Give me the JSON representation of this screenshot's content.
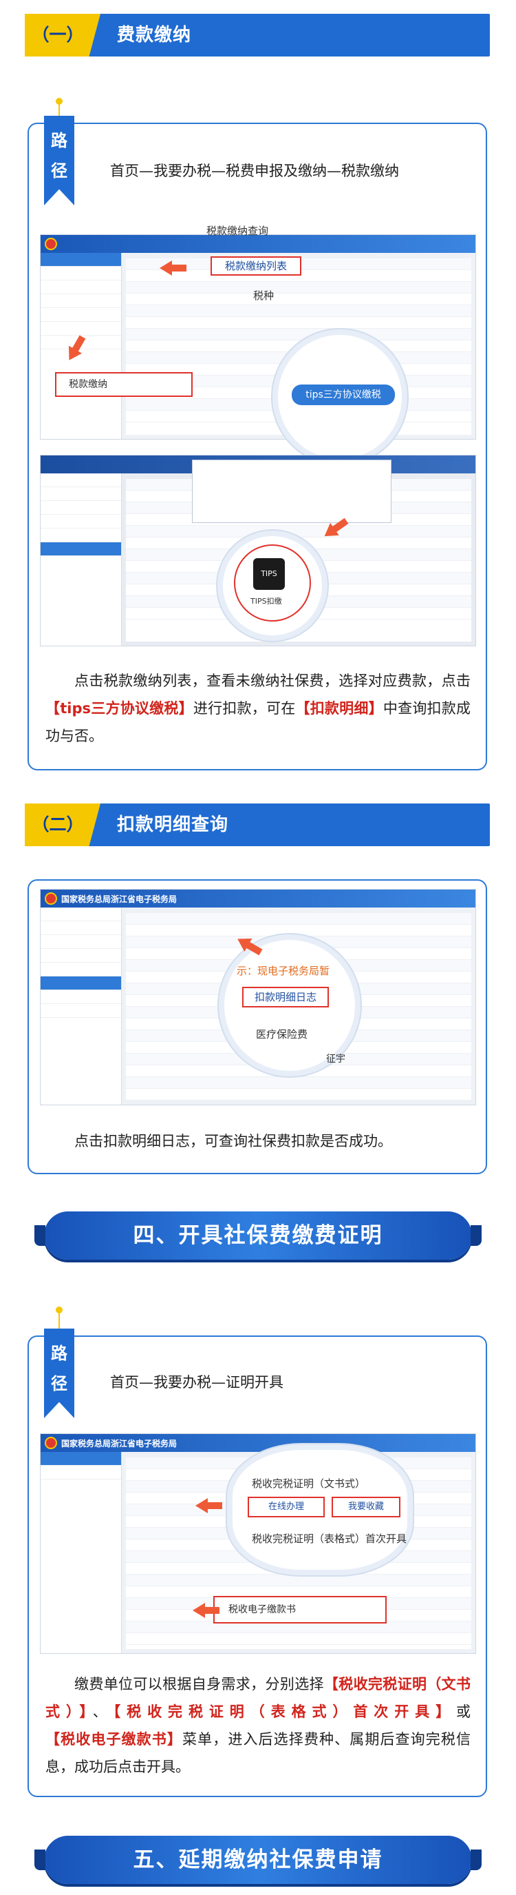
{
  "section1": {
    "num": "（一）",
    "title": "费款缴纳"
  },
  "card1": {
    "path_label": [
      "路",
      "径"
    ],
    "path": "首页—我要办税—税费申报及缴纳—税款缴纳",
    "shot1": {
      "callout_title": "税款缴纳查询",
      "list_label": "税款缴纳列表",
      "col_label": "税种",
      "side_label": "税款缴纳",
      "tips_button": "tips三方协议缴税"
    },
    "shot2": {
      "tips_icon": "TIPS",
      "tips_caption": "TIPS扣缴"
    },
    "desc": {
      "p1": "点击税款缴纳列表，查看未缴纳社保费，选择对应费款，点击",
      "r1": "【tips三方协议缴税】",
      "p2": "进行扣款，可在",
      "r2": "【扣款明细】",
      "p3": "中查询扣款成功与否。"
    }
  },
  "section2": {
    "num": "（二）",
    "title": "扣款明细查询"
  },
  "card2": {
    "shot": {
      "site_title": "国家税务总局浙江省电子税务局",
      "prompt": "示：现电子税务局暂",
      "detail_label": "扣款明细日志",
      "bottom_label": "医疗保险费",
      "corner": "征宇"
    },
    "desc": "点击扣款明细日志，可查询社保费扣款是否成功。"
  },
  "banner4": "四、开具社保费缴费证明",
  "card3": {
    "path_label": [
      "路",
      "径"
    ],
    "path": "首页—我要办税—证明开具",
    "shot": {
      "site_title": "国家税务总局浙江省电子税务局",
      "item1": "税收完税证明（文书式）",
      "btn_online": "在线办理",
      "btn_fav": "我要收藏",
      "item2": "税收完税证明（表格式）首次开具",
      "item3": "税收电子缴款书"
    },
    "desc": {
      "p1": "缴费单位可以根据自身需求，分别选择",
      "r1": "【税收完税证明（文书式）】",
      "p2": "、",
      "r2": "【税收完税证明（表格式）首次开具】",
      "p3": "或",
      "r3": "【税收电子缴款书】",
      "p4": "菜单，进入后选择费种、属期后查询完税信息，成功后点击开具。"
    }
  },
  "banner5": "五、延期缴纳社保费申请",
  "colors": {
    "primary": "#1f6bd1",
    "accent": "#f5c700",
    "red": "#d1241c"
  }
}
